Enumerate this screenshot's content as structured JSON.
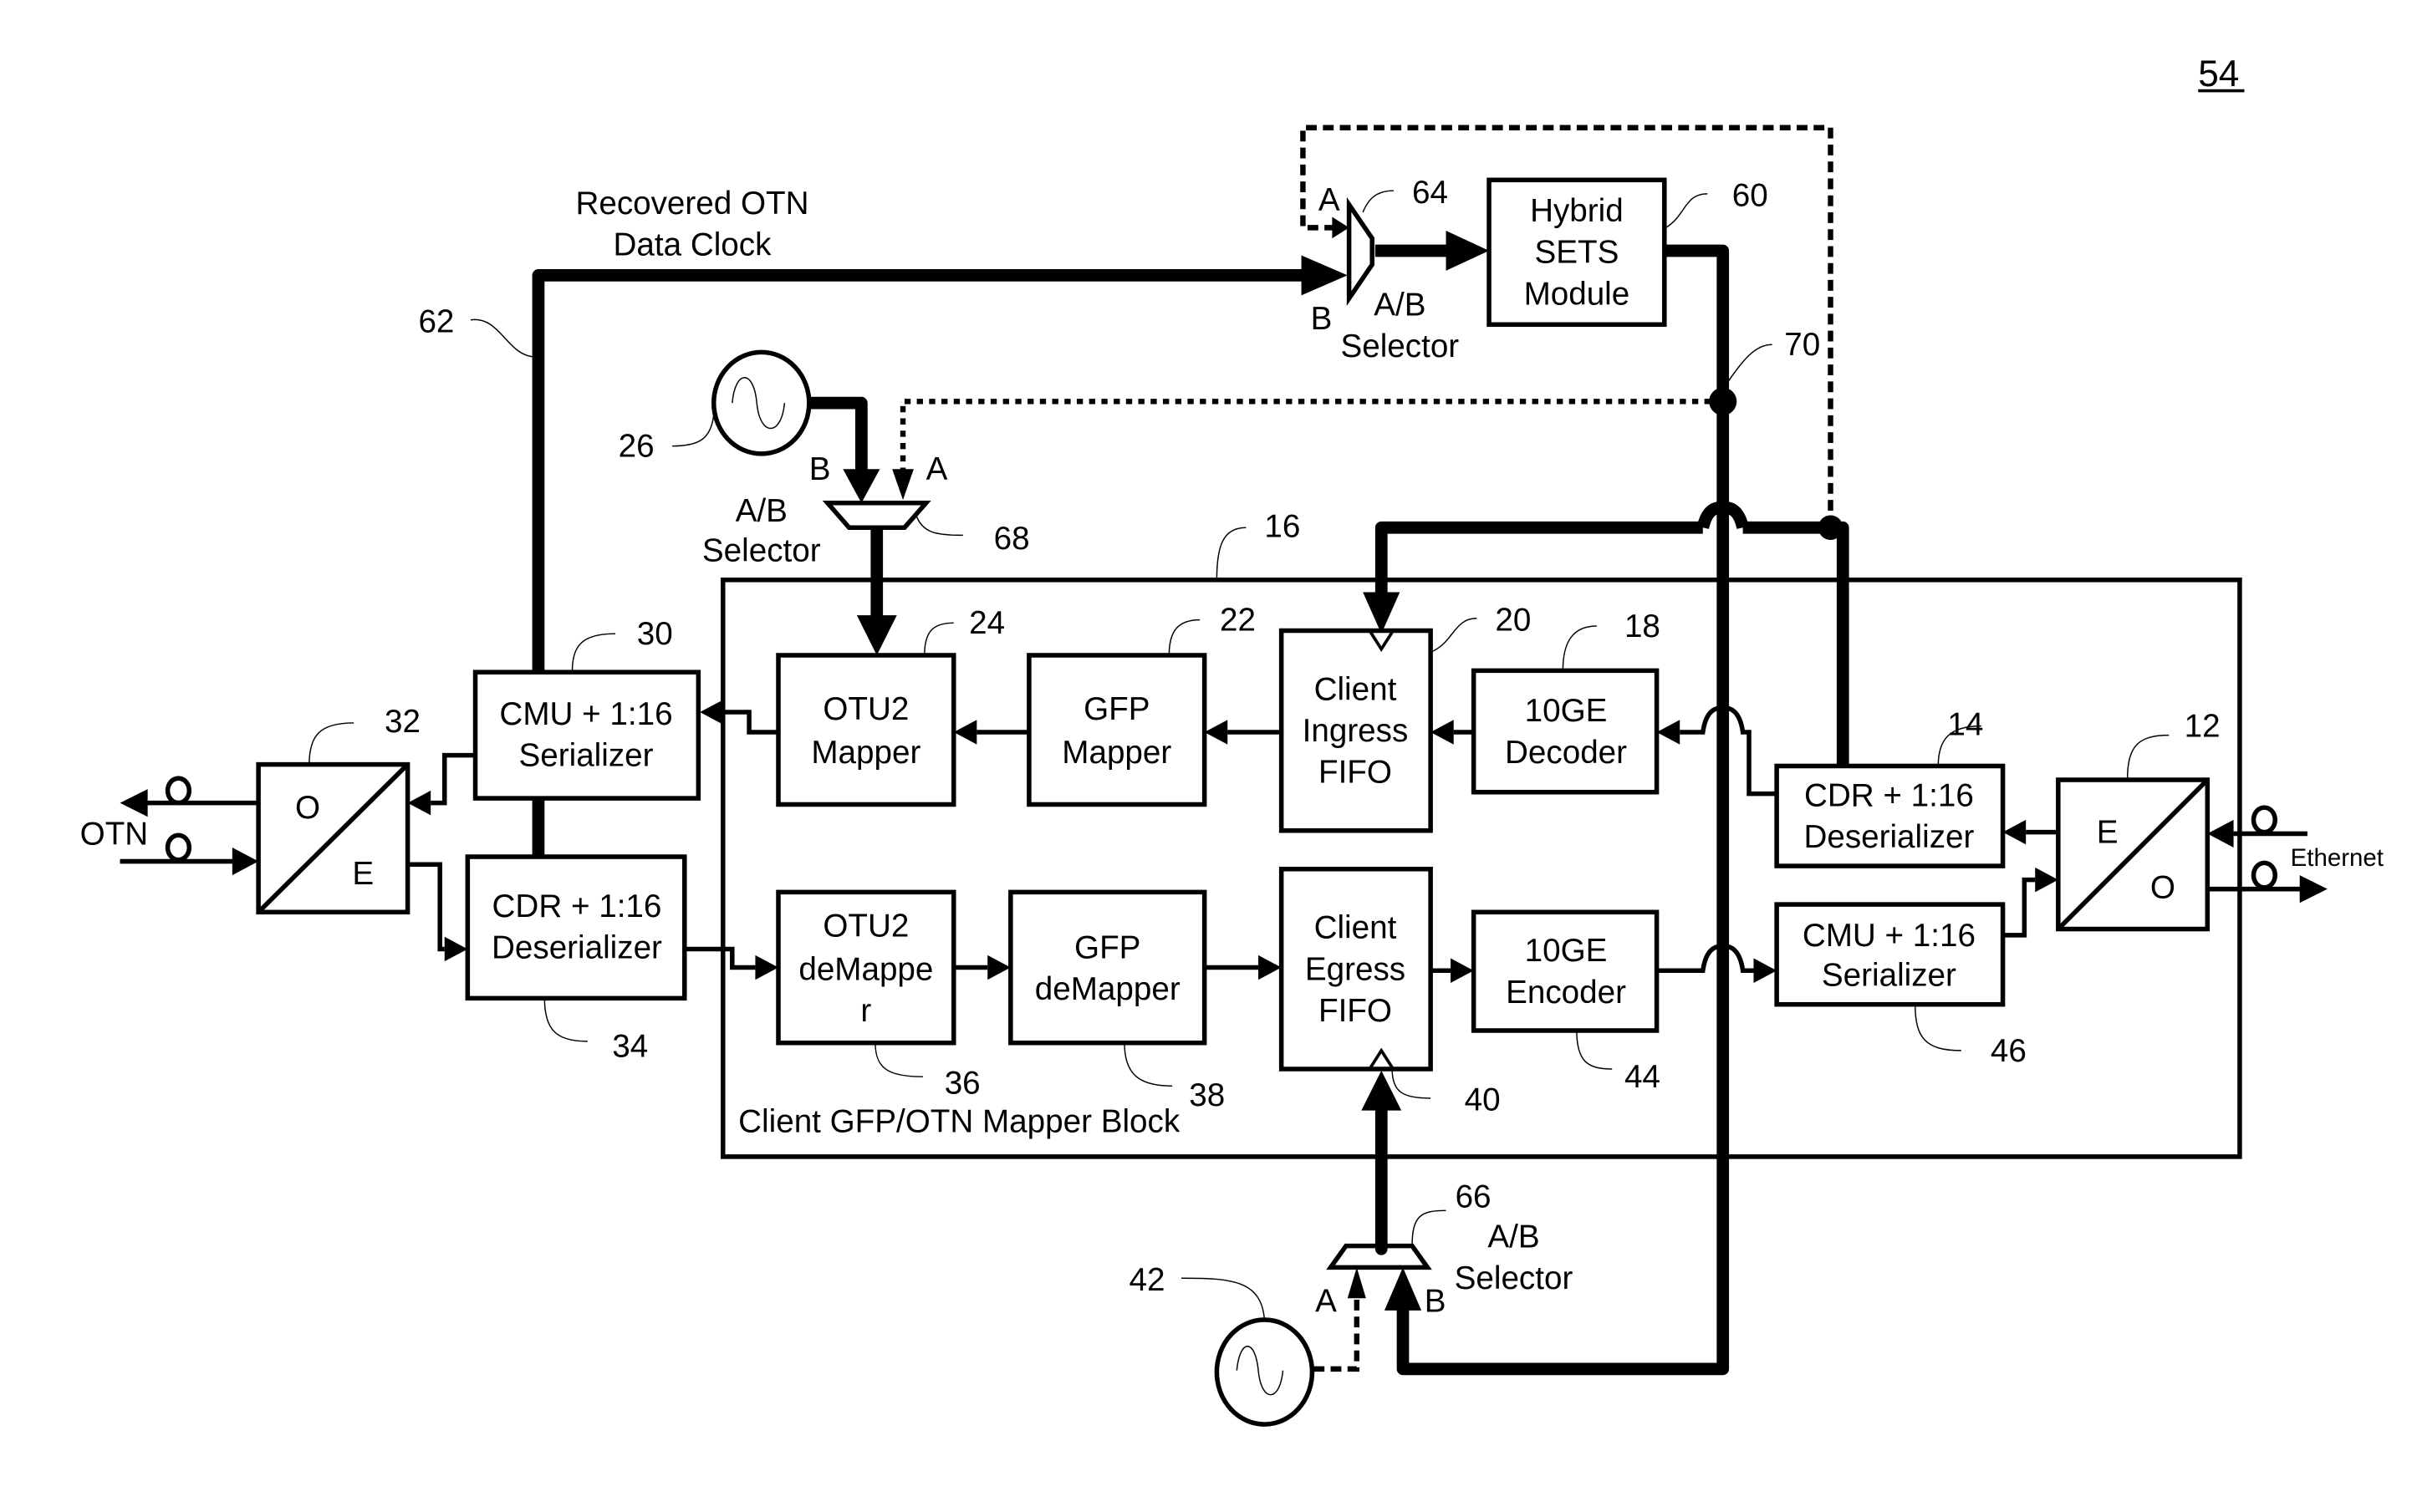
{
  "figure": {
    "number": "54",
    "colors": {
      "ink": "#000000",
      "background": "#ffffff"
    }
  },
  "annotations": {
    "recovered_clock_line1": "Recovered OTN",
    "recovered_clock_line2": "Data Clock",
    "otn": "OTN",
    "ethernet": "Ethernet",
    "mapper_block": "Client GFP/OTN Mapper Block"
  },
  "blocks": {
    "hybrid_sets": {
      "lines": [
        "Hybrid",
        "SETS",
        "Module"
      ],
      "ref": "60"
    },
    "otu2_mapper": {
      "lines": [
        "OTU2",
        "Mapper"
      ],
      "ref": "24"
    },
    "gfp_mapper": {
      "lines": [
        "GFP",
        "Mapper"
      ],
      "ref": "22"
    },
    "client_ingress_fifo": {
      "lines": [
        "Client",
        "Ingress",
        "FIFO"
      ],
      "ref": "20"
    },
    "decoder_10ge": {
      "lines": [
        "10GE",
        "Decoder"
      ],
      "ref": "18"
    },
    "otu2_demapper": {
      "lines": [
        "OTU2",
        "deMappe",
        "r"
      ],
      "ref": "36"
    },
    "gfp_demapper": {
      "lines": [
        "GFP",
        "deMapper"
      ],
      "ref": "38"
    },
    "client_egress_fifo": {
      "lines": [
        "Client",
        "Egress",
        "FIFO"
      ],
      "ref": "40"
    },
    "encoder_10ge": {
      "lines": [
        "10GE",
        "Encoder"
      ],
      "ref": "44"
    },
    "otn_serializer": {
      "lines": [
        "CMU + 1:16",
        "Serializer"
      ],
      "ref": "30"
    },
    "otn_deserializer": {
      "lines": [
        "CDR + 1:16",
        "Deserializer"
      ],
      "ref": "34"
    },
    "eth_deserializer": {
      "lines": [
        "CDR + 1:16",
        "Deserializer"
      ],
      "ref": "14"
    },
    "eth_serializer": {
      "lines": [
        "CMU + 1:16",
        "Serializer"
      ],
      "ref": "46"
    },
    "otn_oe": {
      "top": "O",
      "bottom": "E",
      "ref": "32"
    },
    "eth_eo": {
      "top": "E",
      "bottom": "O",
      "ref": "12"
    },
    "mapper_block_ref": "16"
  },
  "selectors": {
    "sel64": {
      "label_line1": "A/B",
      "label_line2": "Selector",
      "in_a": "A",
      "in_b": "B",
      "ref": "64"
    },
    "sel68": {
      "label_line1": "A/B",
      "label_line2": "Selector",
      "in_a": "A",
      "in_b": "B",
      "ref": "68"
    },
    "sel66": {
      "label_line1": "A/B",
      "label_line2": "Selector",
      "in_a": "A",
      "in_b": "B",
      "ref": "66"
    }
  },
  "oscillators": {
    "osc26": {
      "ref": "26"
    },
    "osc42": {
      "ref": "42"
    }
  },
  "references": {
    "recovered_clock_line": "62",
    "junction": "70"
  }
}
